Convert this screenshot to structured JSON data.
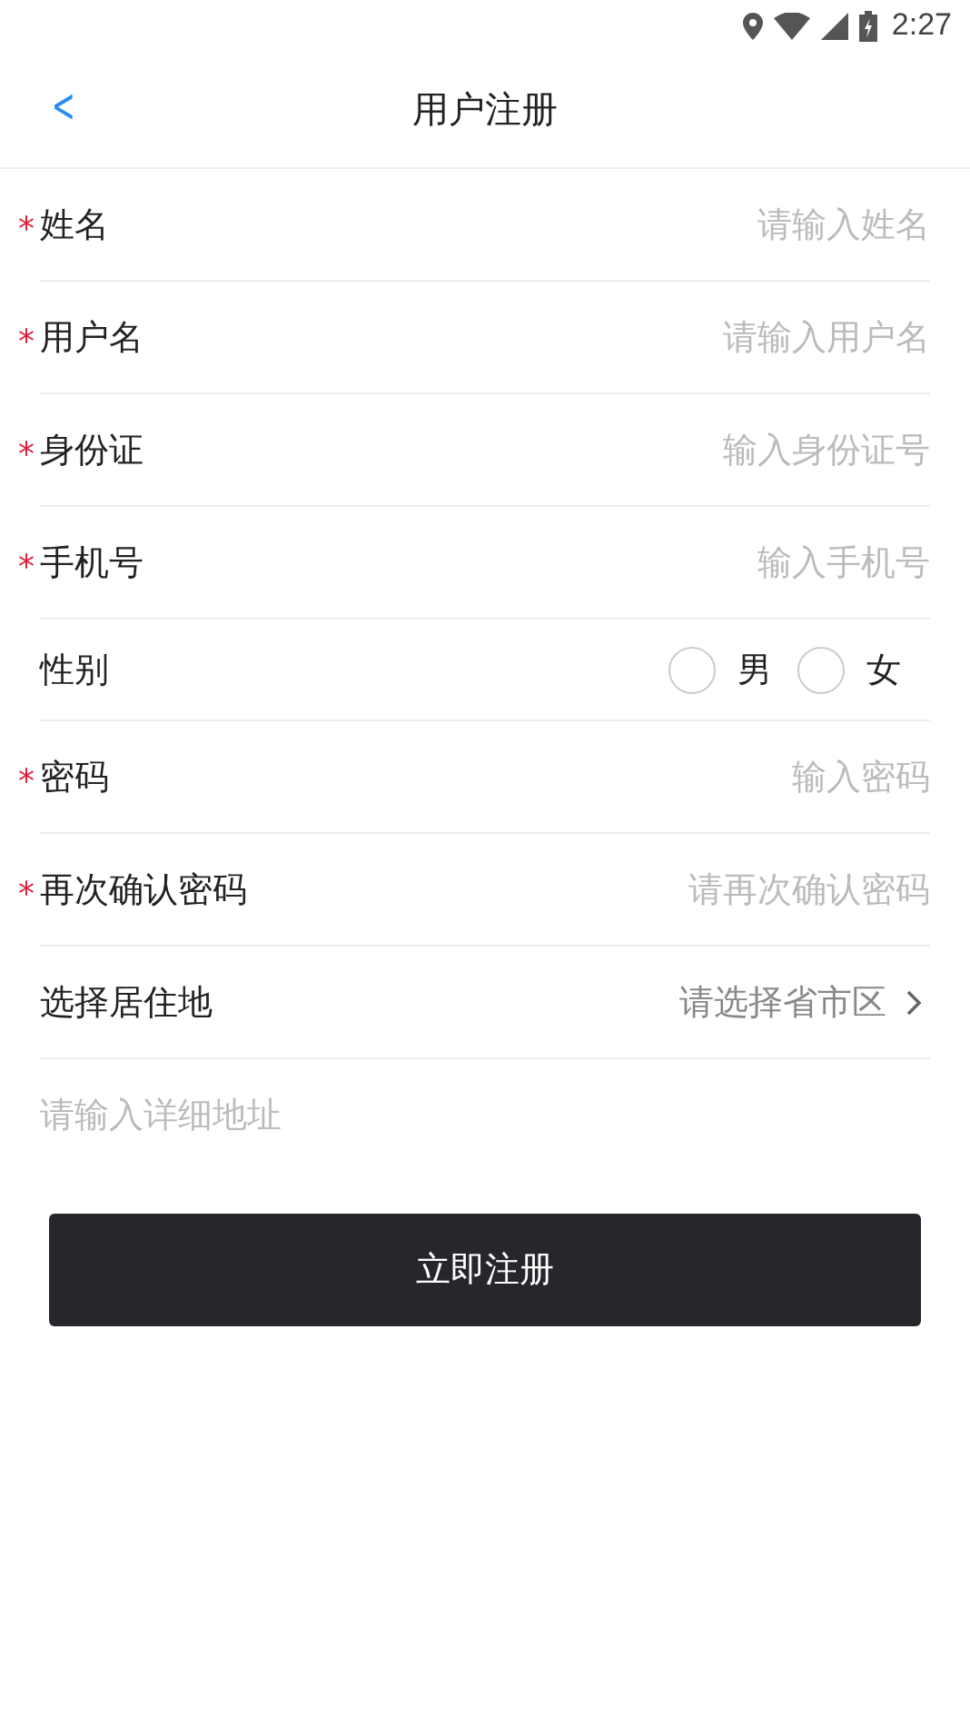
{
  "status_bar": {
    "time": "2:27"
  },
  "header": {
    "back": "<",
    "title": "用户注册"
  },
  "fields": [
    {
      "kind": "input",
      "mark": "*",
      "label": "姓名",
      "placeholder": "请输入姓名"
    },
    {
      "kind": "input",
      "mark": "*",
      "label": "用户名",
      "placeholder": "请输入用户名"
    },
    {
      "kind": "input",
      "mark": "*",
      "label": "身份证",
      "placeholder": "输入身份证号"
    },
    {
      "kind": "input",
      "mark": "*",
      "label": "手机号",
      "placeholder": "输入手机号"
    },
    {
      "kind": "radio",
      "label": "性别",
      "options": [
        {
          "label": "男",
          "selected": false
        },
        {
          "label": "女",
          "selected": false
        }
      ]
    },
    {
      "kind": "input",
      "mark": "*",
      "label": "密码",
      "placeholder": "输入密码"
    },
    {
      "kind": "input",
      "mark": "*",
      "label": "再次确认密码",
      "placeholder": "请再次确认密码"
    },
    {
      "kind": "select",
      "label": "选择居住地",
      "value": "请选择省市区"
    },
    {
      "kind": "address",
      "placeholder": "请输入详细地址"
    }
  ],
  "submit": "立即注册"
}
